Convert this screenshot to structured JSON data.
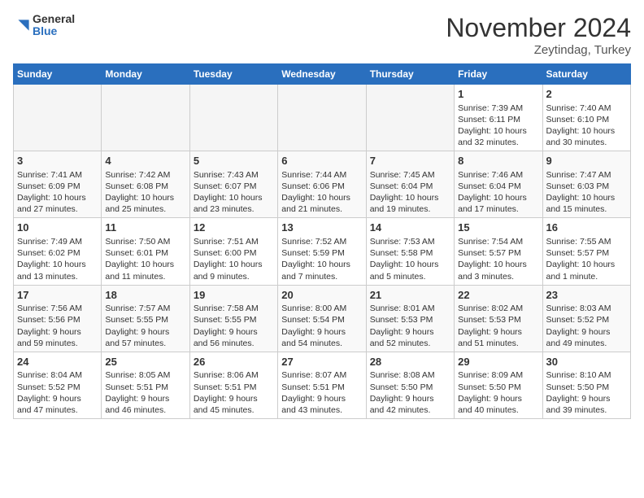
{
  "header": {
    "logo_general": "General",
    "logo_blue": "Blue",
    "month_title": "November 2024",
    "subtitle": "Zeytindag, Turkey"
  },
  "weekdays": [
    "Sunday",
    "Monday",
    "Tuesday",
    "Wednesday",
    "Thursday",
    "Friday",
    "Saturday"
  ],
  "weeks": [
    [
      {
        "day": "",
        "info": ""
      },
      {
        "day": "",
        "info": ""
      },
      {
        "day": "",
        "info": ""
      },
      {
        "day": "",
        "info": ""
      },
      {
        "day": "",
        "info": ""
      },
      {
        "day": "1",
        "info": "Sunrise: 7:39 AM\nSunset: 6:11 PM\nDaylight: 10 hours\nand 32 minutes."
      },
      {
        "day": "2",
        "info": "Sunrise: 7:40 AM\nSunset: 6:10 PM\nDaylight: 10 hours\nand 30 minutes."
      }
    ],
    [
      {
        "day": "3",
        "info": "Sunrise: 7:41 AM\nSunset: 6:09 PM\nDaylight: 10 hours\nand 27 minutes."
      },
      {
        "day": "4",
        "info": "Sunrise: 7:42 AM\nSunset: 6:08 PM\nDaylight: 10 hours\nand 25 minutes."
      },
      {
        "day": "5",
        "info": "Sunrise: 7:43 AM\nSunset: 6:07 PM\nDaylight: 10 hours\nand 23 minutes."
      },
      {
        "day": "6",
        "info": "Sunrise: 7:44 AM\nSunset: 6:06 PM\nDaylight: 10 hours\nand 21 minutes."
      },
      {
        "day": "7",
        "info": "Sunrise: 7:45 AM\nSunset: 6:04 PM\nDaylight: 10 hours\nand 19 minutes."
      },
      {
        "day": "8",
        "info": "Sunrise: 7:46 AM\nSunset: 6:04 PM\nDaylight: 10 hours\nand 17 minutes."
      },
      {
        "day": "9",
        "info": "Sunrise: 7:47 AM\nSunset: 6:03 PM\nDaylight: 10 hours\nand 15 minutes."
      }
    ],
    [
      {
        "day": "10",
        "info": "Sunrise: 7:49 AM\nSunset: 6:02 PM\nDaylight: 10 hours\nand 13 minutes."
      },
      {
        "day": "11",
        "info": "Sunrise: 7:50 AM\nSunset: 6:01 PM\nDaylight: 10 hours\nand 11 minutes."
      },
      {
        "day": "12",
        "info": "Sunrise: 7:51 AM\nSunset: 6:00 PM\nDaylight: 10 hours\nand 9 minutes."
      },
      {
        "day": "13",
        "info": "Sunrise: 7:52 AM\nSunset: 5:59 PM\nDaylight: 10 hours\nand 7 minutes."
      },
      {
        "day": "14",
        "info": "Sunrise: 7:53 AM\nSunset: 5:58 PM\nDaylight: 10 hours\nand 5 minutes."
      },
      {
        "day": "15",
        "info": "Sunrise: 7:54 AM\nSunset: 5:57 PM\nDaylight: 10 hours\nand 3 minutes."
      },
      {
        "day": "16",
        "info": "Sunrise: 7:55 AM\nSunset: 5:57 PM\nDaylight: 10 hours\nand 1 minute."
      }
    ],
    [
      {
        "day": "17",
        "info": "Sunrise: 7:56 AM\nSunset: 5:56 PM\nDaylight: 9 hours\nand 59 minutes."
      },
      {
        "day": "18",
        "info": "Sunrise: 7:57 AM\nSunset: 5:55 PM\nDaylight: 9 hours\nand 57 minutes."
      },
      {
        "day": "19",
        "info": "Sunrise: 7:58 AM\nSunset: 5:55 PM\nDaylight: 9 hours\nand 56 minutes."
      },
      {
        "day": "20",
        "info": "Sunrise: 8:00 AM\nSunset: 5:54 PM\nDaylight: 9 hours\nand 54 minutes."
      },
      {
        "day": "21",
        "info": "Sunrise: 8:01 AM\nSunset: 5:53 PM\nDaylight: 9 hours\nand 52 minutes."
      },
      {
        "day": "22",
        "info": "Sunrise: 8:02 AM\nSunset: 5:53 PM\nDaylight: 9 hours\nand 51 minutes."
      },
      {
        "day": "23",
        "info": "Sunrise: 8:03 AM\nSunset: 5:52 PM\nDaylight: 9 hours\nand 49 minutes."
      }
    ],
    [
      {
        "day": "24",
        "info": "Sunrise: 8:04 AM\nSunset: 5:52 PM\nDaylight: 9 hours\nand 47 minutes."
      },
      {
        "day": "25",
        "info": "Sunrise: 8:05 AM\nSunset: 5:51 PM\nDaylight: 9 hours\nand 46 minutes."
      },
      {
        "day": "26",
        "info": "Sunrise: 8:06 AM\nSunset: 5:51 PM\nDaylight: 9 hours\nand 45 minutes."
      },
      {
        "day": "27",
        "info": "Sunrise: 8:07 AM\nSunset: 5:51 PM\nDaylight: 9 hours\nand 43 minutes."
      },
      {
        "day": "28",
        "info": "Sunrise: 8:08 AM\nSunset: 5:50 PM\nDaylight: 9 hours\nand 42 minutes."
      },
      {
        "day": "29",
        "info": "Sunrise: 8:09 AM\nSunset: 5:50 PM\nDaylight: 9 hours\nand 40 minutes."
      },
      {
        "day": "30",
        "info": "Sunrise: 8:10 AM\nSunset: 5:50 PM\nDaylight: 9 hours\nand 39 minutes."
      }
    ]
  ]
}
